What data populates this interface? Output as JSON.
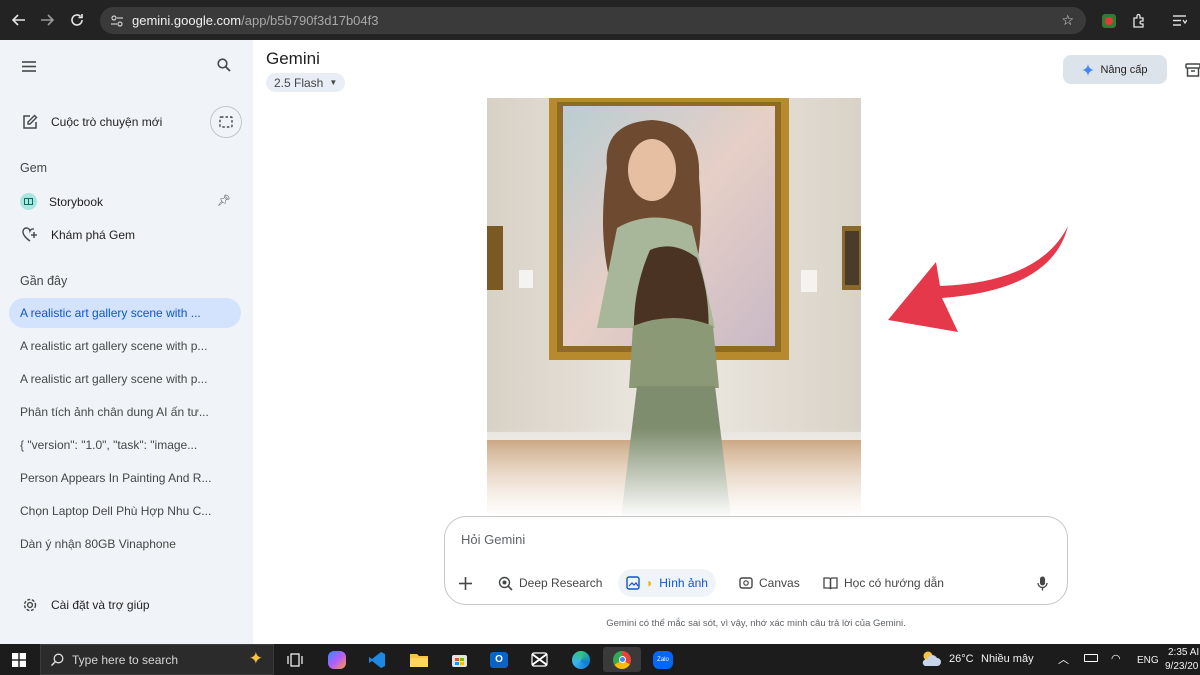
{
  "browser": {
    "url_host": "gemini.google.com",
    "url_path": "/app/b5b790f3d17b04f3"
  },
  "sidebar": {
    "new_chat_label": "Cuộc trò chuyện mới",
    "gem_heading": "Gem",
    "gems": [
      {
        "label": "Storybook"
      },
      {
        "label": "Khám phá Gem"
      }
    ],
    "recent_heading": "Gần đây",
    "recent": [
      {
        "label": "A realistic art gallery scene with ..."
      },
      {
        "label": "A realistic art gallery scene with p..."
      },
      {
        "label": "A realistic art gallery scene with p..."
      },
      {
        "label": "Phân tích ảnh chân dung AI ấn tư..."
      },
      {
        "label": "{   \"version\": \"1.0\",   \"task\": \"image..."
      },
      {
        "label": "Person Appears In Painting And R..."
      },
      {
        "label": "Chọn Laptop Dell Phù Hợp Nhu C..."
      },
      {
        "label": "Dàn ý nhận 80GB Vinaphone"
      }
    ],
    "settings_label": "Cài đặt và trợ giúp"
  },
  "main": {
    "brand": "Gemini",
    "model_label": "2.5 Flash",
    "upgrade_label": "Nâng cấp",
    "prompt_placeholder": "Hỏi Gemini",
    "tools": [
      {
        "label": "Deep Research"
      },
      {
        "label": "Hình ảnh"
      },
      {
        "label": "Canvas"
      },
      {
        "label": "Học có hướng dẫn"
      }
    ],
    "disclaimer": "Gemini có thể mắc sai sót, vì vậy, nhớ xác minh câu trả lời của Gemini."
  },
  "taskbar": {
    "search_placeholder": "Type here to search",
    "weather_temp": "26°C",
    "weather_desc": "Nhiều mây",
    "language": "ENG",
    "time": "2:35 AI",
    "date": "9/23/20"
  },
  "colors": {
    "sidebar_bg": "#f0f4f9",
    "active_item_bg": "#d3e3fd",
    "accent": "#0b57d0",
    "arrow": "#e5384a"
  }
}
